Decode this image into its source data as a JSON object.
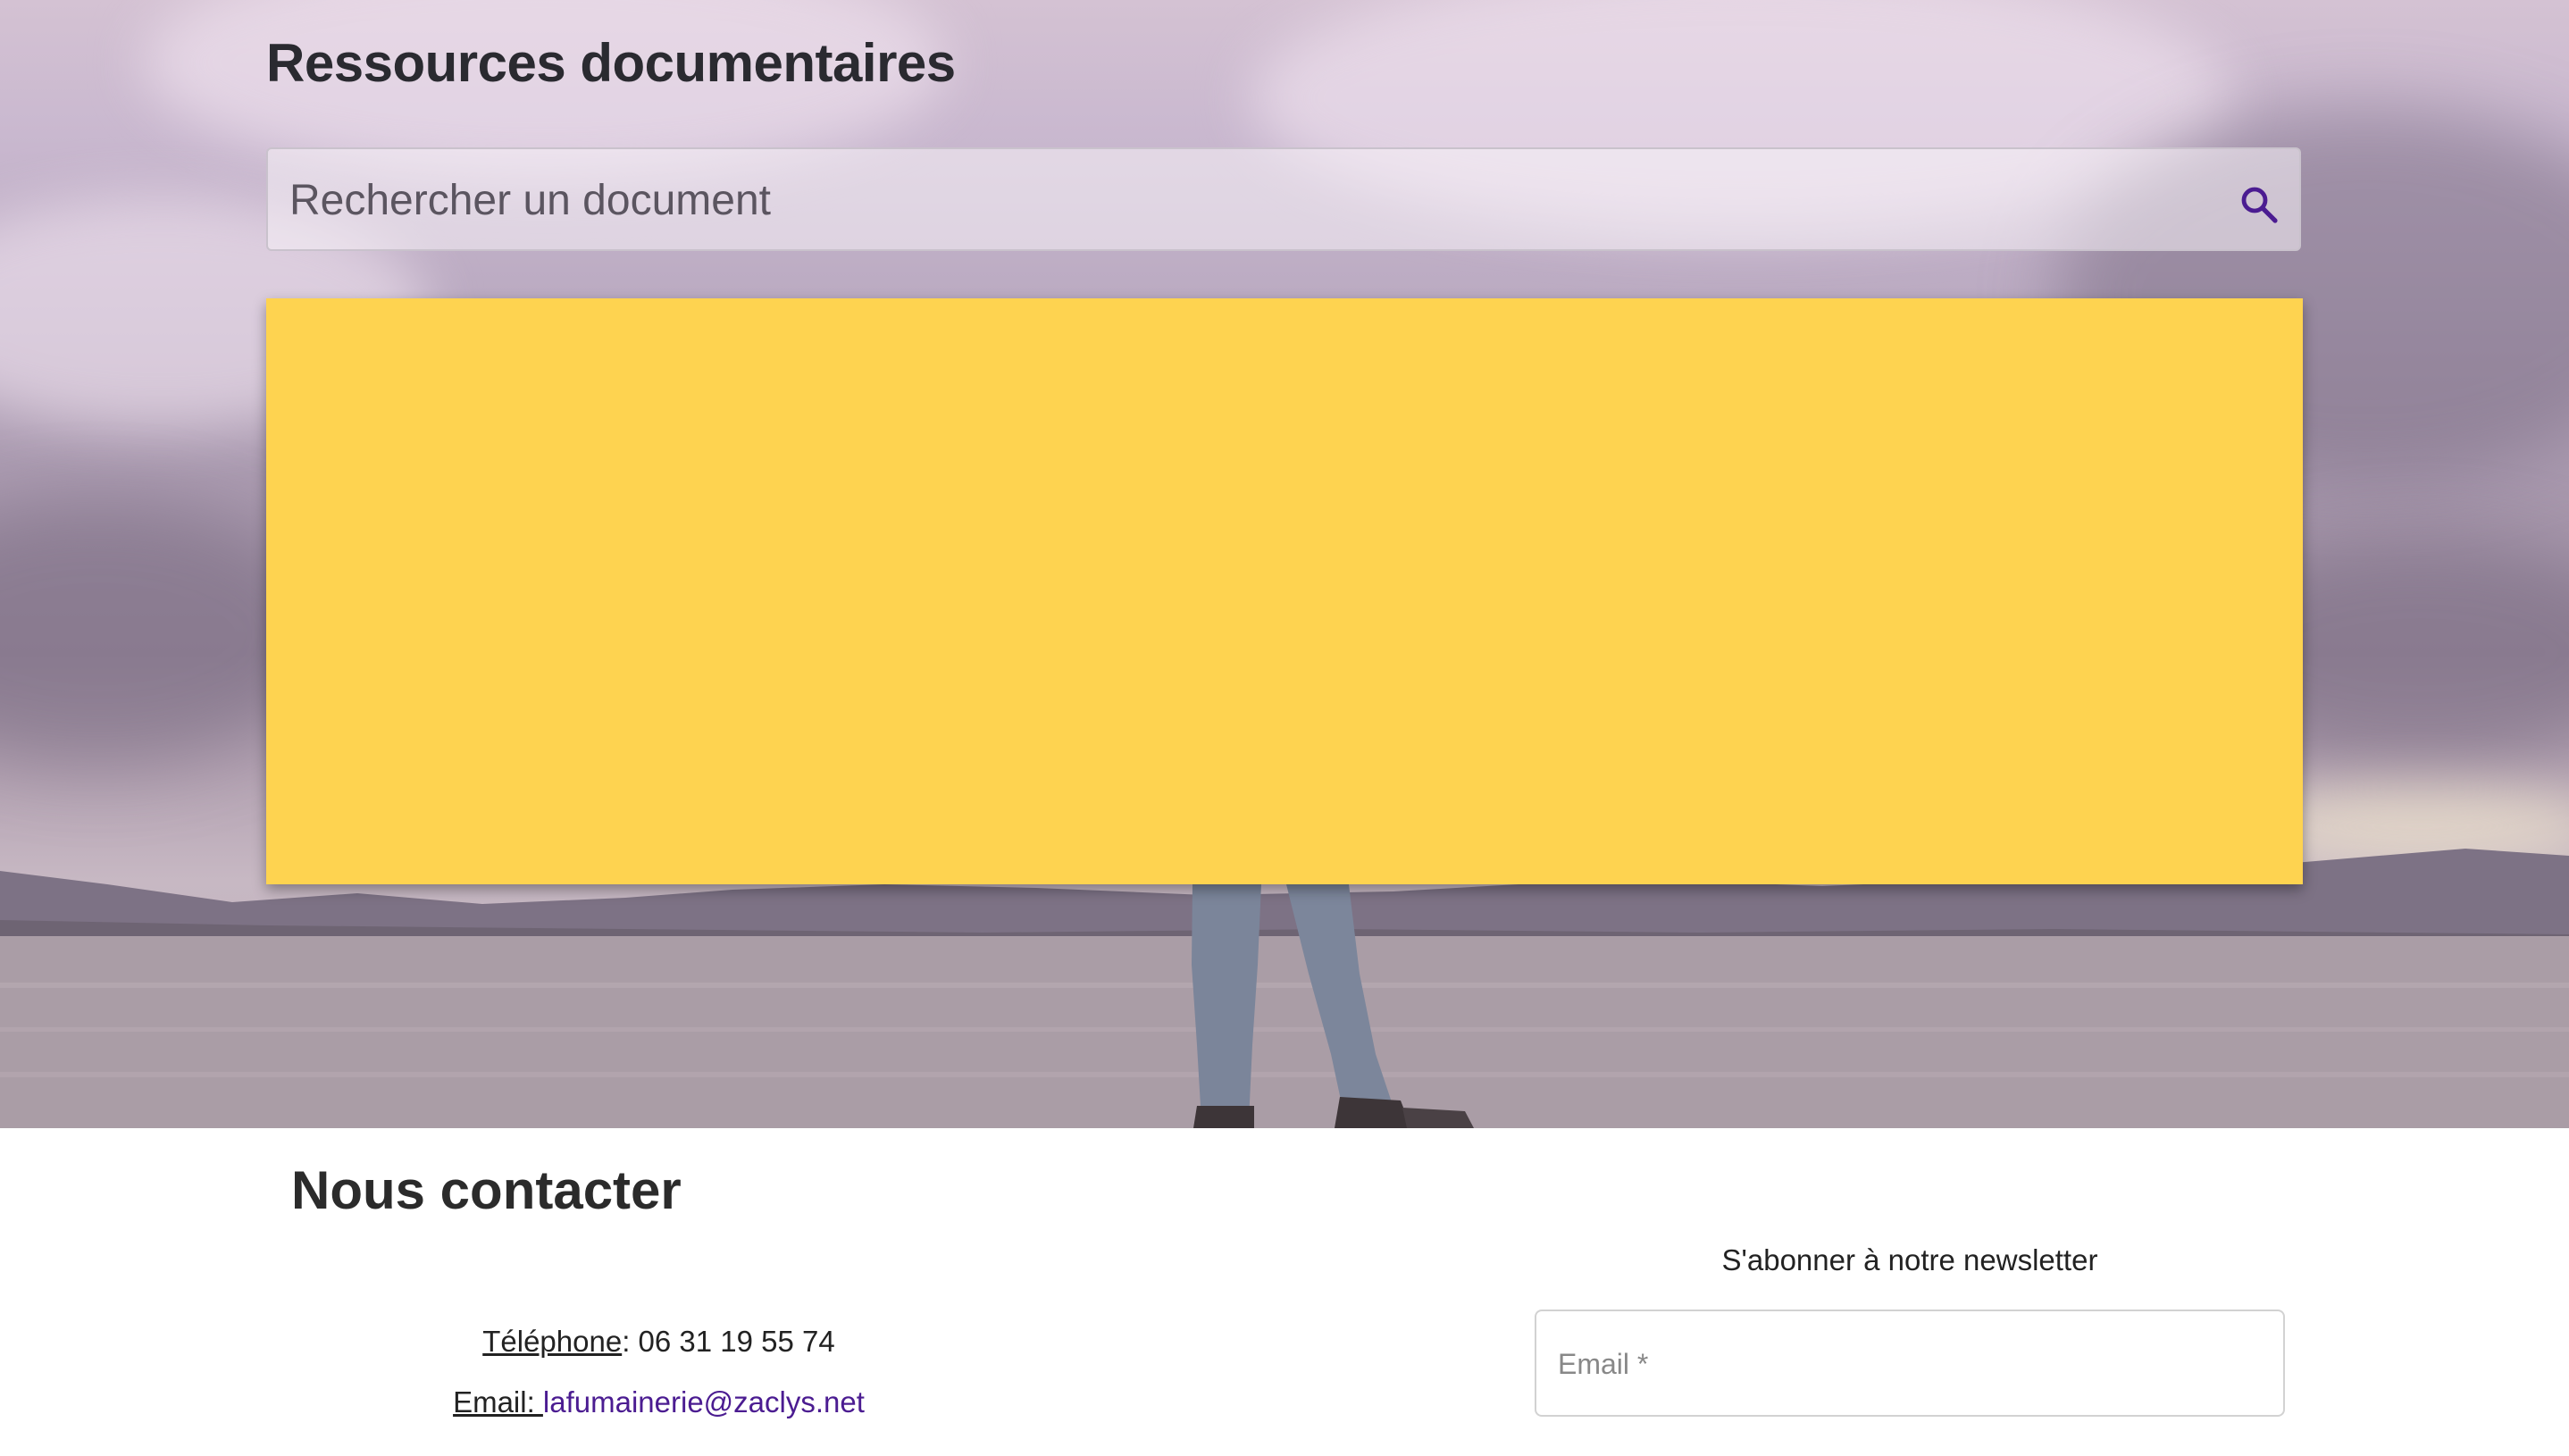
{
  "header": {
    "title": "Ressources documentaires"
  },
  "search": {
    "placeholder": "Rechercher un document",
    "icon": "search-icon"
  },
  "colors": {
    "accent": "#4b1c91",
    "panel": "#fed350"
  },
  "contact": {
    "title": "Nous contacter",
    "phone_label": "Téléphone",
    "phone_sep": ": ",
    "phone_value": "06 31 19 55 74",
    "email_label": "Email: ",
    "email_value": "lafumainerie@zaclys.net"
  },
  "newsletter": {
    "label": "S'abonner à notre newsletter",
    "email_placeholder": "Email *"
  }
}
